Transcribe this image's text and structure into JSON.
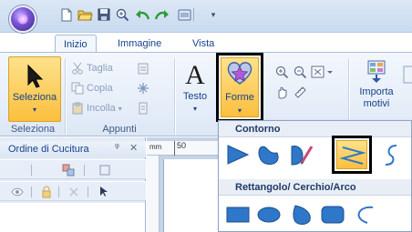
{
  "tabs": [
    {
      "label": "Inizio",
      "active": true
    },
    {
      "label": "Immagine",
      "active": false
    },
    {
      "label": "Vista",
      "active": false
    }
  ],
  "quick_access": {
    "icons": [
      "new-file-icon",
      "open-folder-icon",
      "save-icon",
      "zoom-icon",
      "undo-icon",
      "redo-icon",
      "screen-icon"
    ],
    "dropdown_glyph": "▾"
  },
  "ribbon": {
    "selection_group": {
      "button_label": "Seleziona",
      "group_label": "Seleziona"
    },
    "clipboard_group": {
      "cut_label": "Taglia",
      "copy_label": "Copia",
      "paste_label": "Incolla",
      "group_label": "Appunti"
    },
    "text_button": {
      "label": "Testo",
      "glyph": "A"
    },
    "shapes_button": {
      "label": "Forme"
    },
    "import_button": {
      "label_line1": "Importa",
      "label_line2": "motivi"
    }
  },
  "shapes_dropdown": {
    "sections": [
      {
        "title": "Contorno",
        "shapes": [
          "angle-shape",
          "blob-shape",
          "leaf-shape",
          "zigzag-shape",
          "curve-shape"
        ],
        "selected": "zigzag-shape"
      },
      {
        "title": "Rettangolo/ Cerchio/Arco",
        "shapes": [
          "rectangle-shape",
          "ellipse-shape",
          "drop-shape",
          "rounded-rect-shape",
          "arc-shape"
        ]
      }
    ]
  },
  "left_panel": {
    "title": "Ordine di Cucitura",
    "pin_glyph": "ᵠ",
    "close_glyph": "✕"
  },
  "ruler": {
    "unit": "mm",
    "tick_label": "50"
  },
  "colors": {
    "accent_highlight": "#fcd35a",
    "selection_frame": "#000000",
    "ribbon_text": "#15428b"
  }
}
